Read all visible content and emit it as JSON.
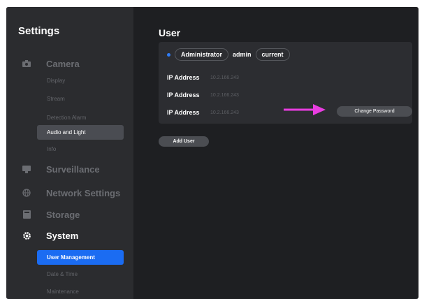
{
  "sidebar": {
    "title": "Settings",
    "sections": [
      {
        "label": "Camera",
        "icon": "camera-icon"
      },
      {
        "label": "Surveillance",
        "icon": "surveillance-icon"
      },
      {
        "label": "Network Settings",
        "icon": "globe-icon"
      },
      {
        "label": "Storage",
        "icon": "storage-icon"
      },
      {
        "label": "System",
        "icon": "gear-icon"
      }
    ],
    "camera_items": [
      "Display",
      "Stream",
      "Detection Alarm",
      "Audio and Light",
      "Info"
    ],
    "system_items": [
      "User Management",
      "Date & Time",
      "Maintenance"
    ]
  },
  "main": {
    "title": "User",
    "user": {
      "role": "Administrator",
      "name": "admin",
      "status": "current"
    },
    "ip_rows": [
      {
        "label": "IP Address",
        "value": "10.2.166.243"
      },
      {
        "label": "IP Address",
        "value": "10.2.166.243"
      },
      {
        "label": "IP Address",
        "value": "10.2.166.243"
      }
    ],
    "change_password_label": "Change Password",
    "add_user_label": "Add User"
  },
  "colors": {
    "accent": "#1b6cf2",
    "annotation_arrow": "#e83de0",
    "background": "#1e1f22",
    "sidebar": "#2b2c2f",
    "card": "#2c2d31"
  }
}
